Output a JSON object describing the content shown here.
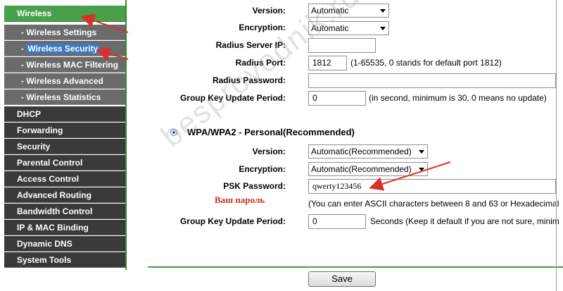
{
  "sidebar": {
    "menu_top": "Wireless",
    "submenu": [
      "- Wireless Settings",
      "- Wireless Security",
      "- Wireless MAC Filtering",
      "- Wireless Advanced",
      "- Wireless Statistics"
    ],
    "submenu_prefix_security": "- ",
    "submenu_selected_text": "Wireless Security",
    "menu": [
      "DHCP",
      "Forwarding",
      "Security",
      "Parental Control",
      "Access Control",
      "Advanced Routing",
      "Bandwidth Control",
      "IP & MAC Binding",
      "Dynamic DNS",
      "System Tools"
    ]
  },
  "wpa_enterprise": {
    "version_label": "Version:",
    "version_value": "Automatic",
    "encryption_label": "Encryption:",
    "encryption_value": "Automatic",
    "radius_ip_label": "Radius Server IP:",
    "radius_ip_value": "",
    "radius_port_label": "Radius Port:",
    "radius_port_value": "1812",
    "radius_port_hint": "(1-65535, 0 stands for default port 1812)",
    "radius_password_label": "Radius Password:",
    "radius_password_value": "",
    "group_key_label": "Group Key Update Period:",
    "group_key_value": "0",
    "group_key_hint": "(in second, minimum is 30, 0 means no update)"
  },
  "wpa_personal": {
    "title": "WPA/WPA2 - Personal(Recommended)",
    "version_label": "Version:",
    "version_value": "Automatic(Recommended)",
    "encryption_label": "Encryption:",
    "encryption_value": "Automatic(Recommended)",
    "psk_label": "PSK Password:",
    "psk_value": "qwerty123456",
    "psk_hint": "(You can enter ASCII characters between 8 and 63 or Hexadecimal",
    "group_key_label": "Group Key Update Period:",
    "group_key_value": "0",
    "group_key_hint": "Seconds (Keep it default if you are not sure, minim"
  },
  "annotation": {
    "password_note": "Ваш пароль"
  },
  "save_label": "Save",
  "watermark": "besprovodnik.ru",
  "colors": {
    "menu_active": "#49a04a",
    "menu_dark": "#3a3a3a",
    "submenu": "#6b6b6b",
    "arrow": "#d9302a"
  }
}
